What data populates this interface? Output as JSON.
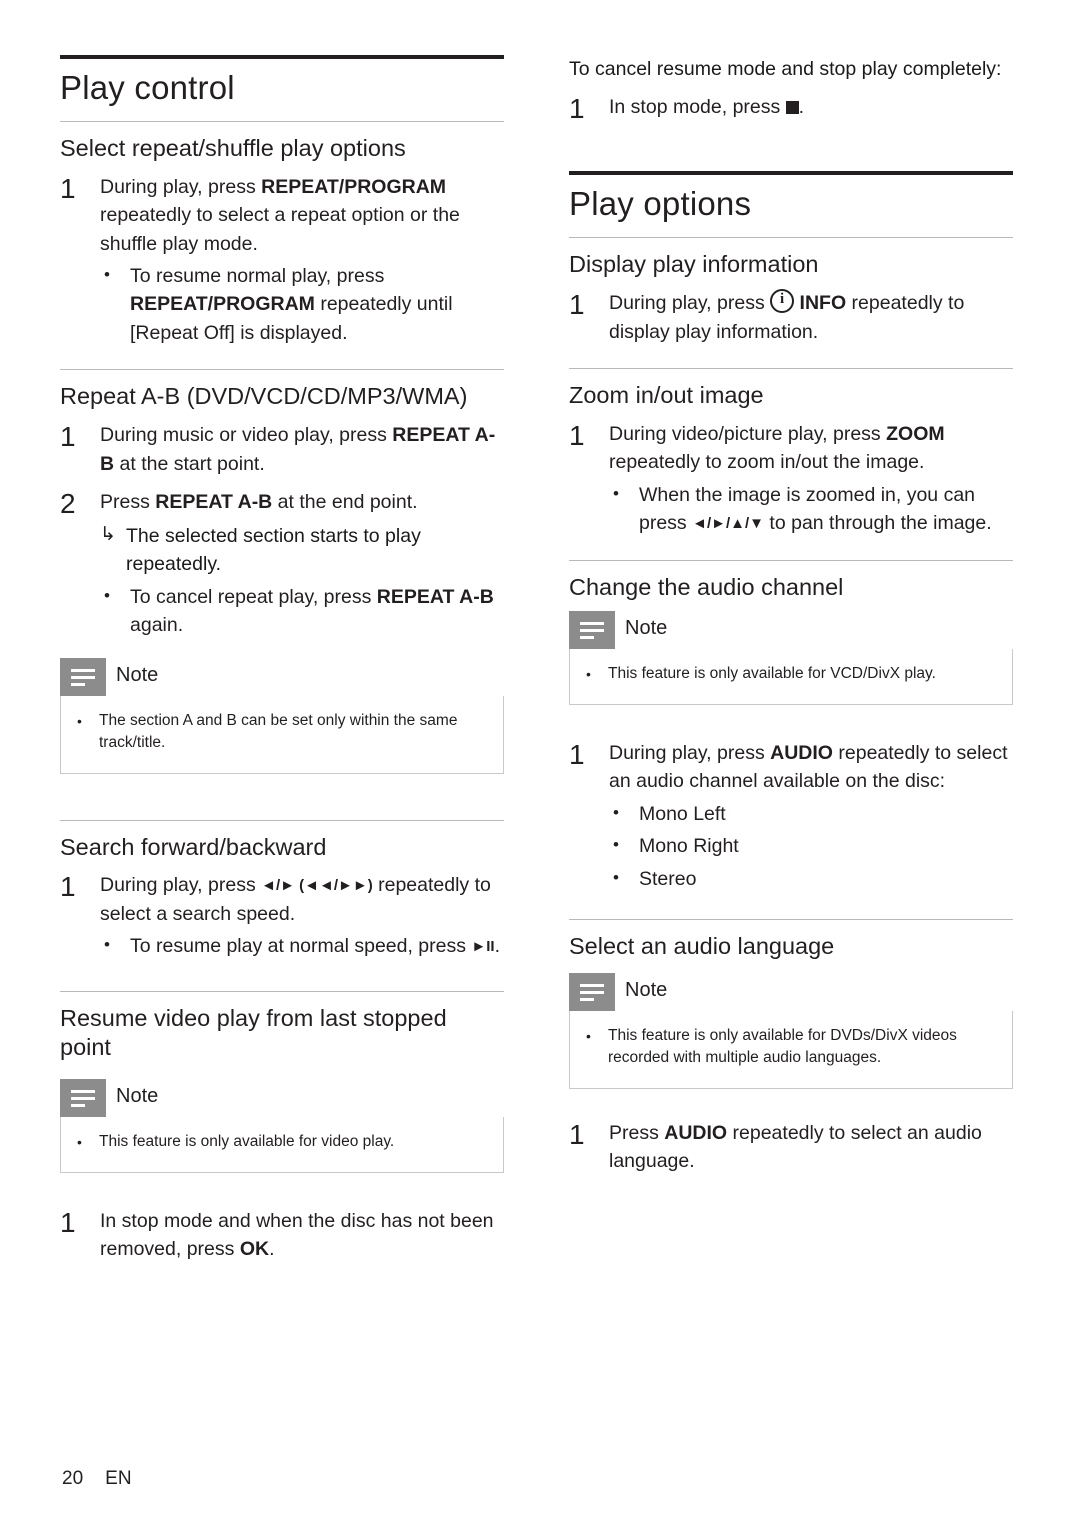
{
  "document": {
    "page_number": "20",
    "language_code": "EN"
  },
  "left_column": {
    "chapter_title": "Play control",
    "sections": [
      {
        "heading": "Select repeat/shuffle play options",
        "step1_num": "1",
        "step1_a": "During play, press ",
        "step1_b": "REPEAT/PROGRAM",
        "step1_c": " repeatedly to select a repeat option or the shuffle play mode.",
        "bullet1_a": "To resume normal play, press ",
        "bullet1_b": "REPEAT/PROGRAM",
        "bullet1_c": " repeatedly until [Repeat Off] is displayed."
      },
      {
        "heading": "Repeat A-B (DVD/VCD/CD/MP3/WMA)",
        "step1_num": "1",
        "step1_a": "During music or video play, press ",
        "step1_b": "REPEAT A-B",
        "step1_c": " at the start point.",
        "step2_num": "2",
        "step2_a": "Press ",
        "step2_b": "REPEAT A-B",
        "step2_c": " at the end point.",
        "arrow_text": "The selected section starts to play repeatedly.",
        "bullet1_a": "To cancel repeat play, press ",
        "bullet1_b": "REPEAT A-B",
        "bullet1_c": " again.",
        "note_label": "Note",
        "note_text": "The section A and B can be set only within the same track/title."
      },
      {
        "heading": "Search forward/backward",
        "step1_num": "1",
        "step1_a": "During play, press ",
        "step1_keys": "◄/► (◄◄/►►)",
        "step1_c": " repeatedly to select a search speed.",
        "bullet1_a": "To resume play at normal speed, press ",
        "bullet1_key": "►II",
        "bullet1_c": "."
      },
      {
        "heading": "Resume video play from last stopped point",
        "note_label": "Note",
        "note_text": "This feature is only available for video play.",
        "step1_num": "1",
        "step1_a": "In stop mode and when the disc has not been removed, press ",
        "step1_b": "OK",
        "step1_c": "."
      }
    ]
  },
  "right_column": {
    "continued": {
      "lead_text": "To cancel resume mode and stop play completely:",
      "step1_num": "1",
      "step1_a": "In stop mode, press ",
      "step1_c": "."
    },
    "chapter_title": "Play options",
    "sections": [
      {
        "heading": "Display play information",
        "step1_num": "1",
        "step1_a": "During play, press ",
        "step1_b": "INFO",
        "step1_c": " repeatedly to display play information."
      },
      {
        "heading": "Zoom in/out image",
        "step1_num": "1",
        "step1_a": "During video/picture play, press ",
        "step1_b": "ZOOM",
        "step1_c": " repeatedly to zoom in/out the image.",
        "bullet1_a": "When the image is zoomed in, you can press ",
        "bullet1_keys": "◄/►/▲/▼",
        "bullet1_c": " to pan through the image."
      },
      {
        "heading": "Change the audio channel",
        "note_label": "Note",
        "note_text": "This feature is only available for VCD/DivX play.",
        "step1_num": "1",
        "step1_a": "During play, press ",
        "step1_b": "AUDIO",
        "step1_c": " repeatedly to select an audio channel available on the disc:",
        "options": [
          "Mono Left",
          "Mono Right",
          "Stereo"
        ]
      },
      {
        "heading": "Select an audio language",
        "note_label": "Note",
        "note_text": "This feature is only available for DVDs/DivX videos recorded with multiple audio languages.",
        "step1_num": "1",
        "step1_a": "Press ",
        "step1_b": "AUDIO",
        "step1_c": " repeatedly to select an audio language."
      }
    ]
  }
}
